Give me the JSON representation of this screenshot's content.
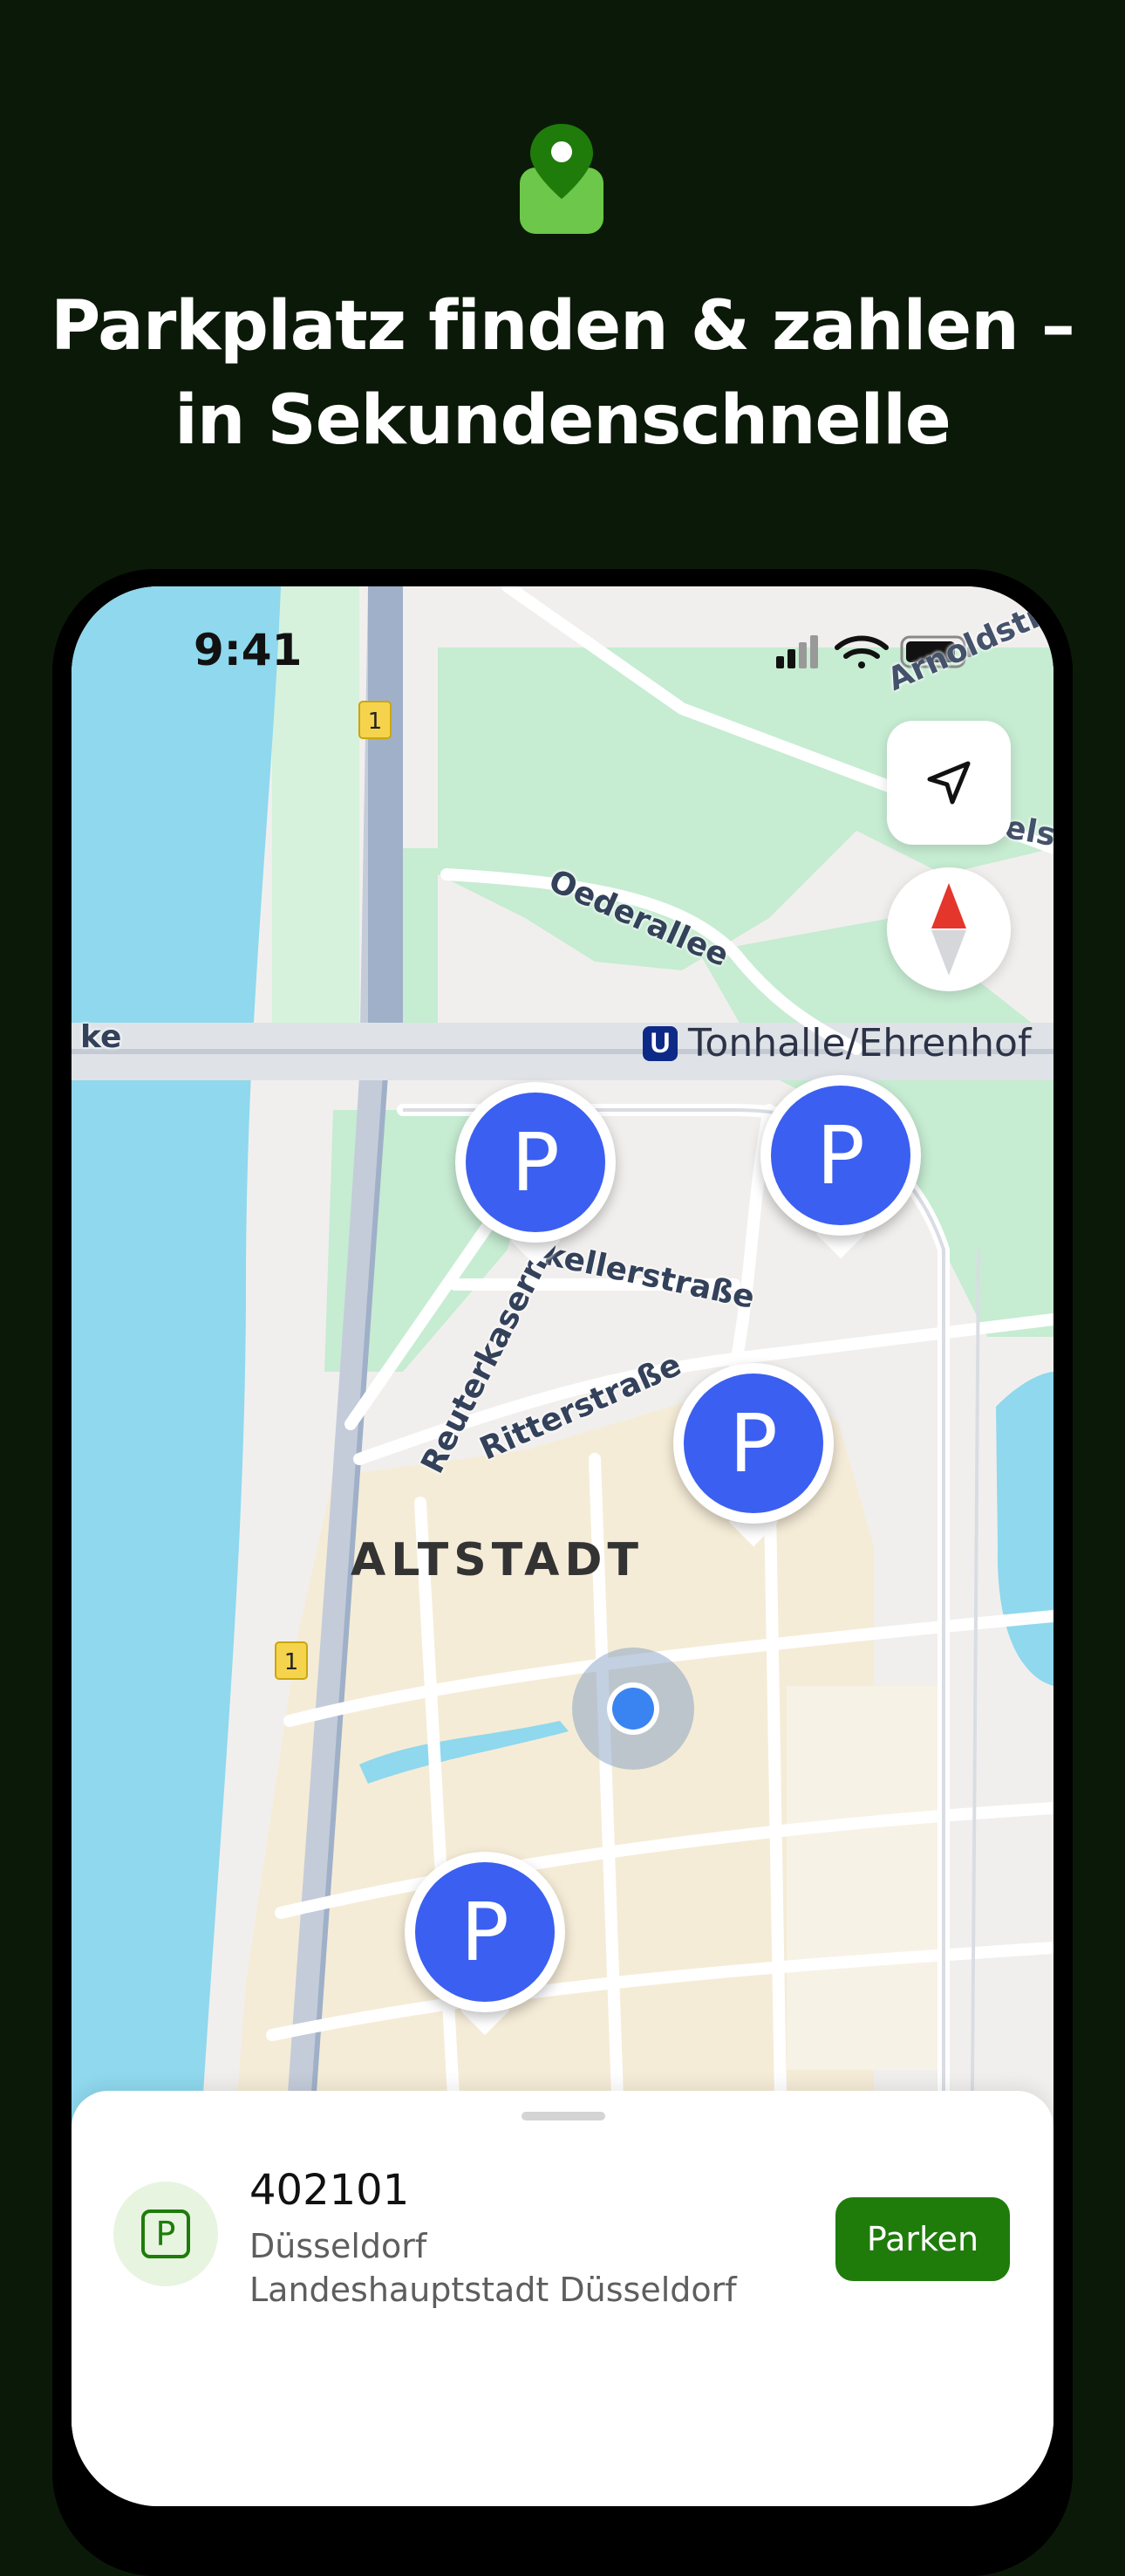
{
  "colors": {
    "background": "#0b1a08",
    "brand_green": "#1f7c0b",
    "pin_blue": "#3b5ff0",
    "water": "#8fd8ee",
    "park": "#c6ecd2"
  },
  "headline": {
    "line1": "Parkplatz finden & zahlen –",
    "line2": "in Sekundenschnelle"
  },
  "status_bar": {
    "time": "9:41",
    "icons": [
      "cellular-signal-icon",
      "wifi-icon",
      "battery-icon"
    ]
  },
  "map": {
    "district": "ALTSTADT",
    "station": {
      "badge": "U",
      "name": "Tonhalle/Ehrenhof"
    },
    "roads": {
      "oederallee": "Oederallee",
      "reuterkaserne": "Reuterkaserne",
      "ritterstrasse": "Ritterstraße",
      "kellerstrasse": "kellerstraße",
      "ke": "ke",
      "arnoldstr": "Arnoldstr",
      "elst": "elst"
    },
    "highway_shield": "1",
    "parking_pin_label": "P",
    "controls": [
      "location-arrow-icon",
      "compass-icon"
    ]
  },
  "parking_zone": {
    "icon_label": "P",
    "number": "402101",
    "city": "Düsseldorf",
    "operator": "Landeshauptstadt Düsseldorf",
    "action_label": "Parken"
  }
}
